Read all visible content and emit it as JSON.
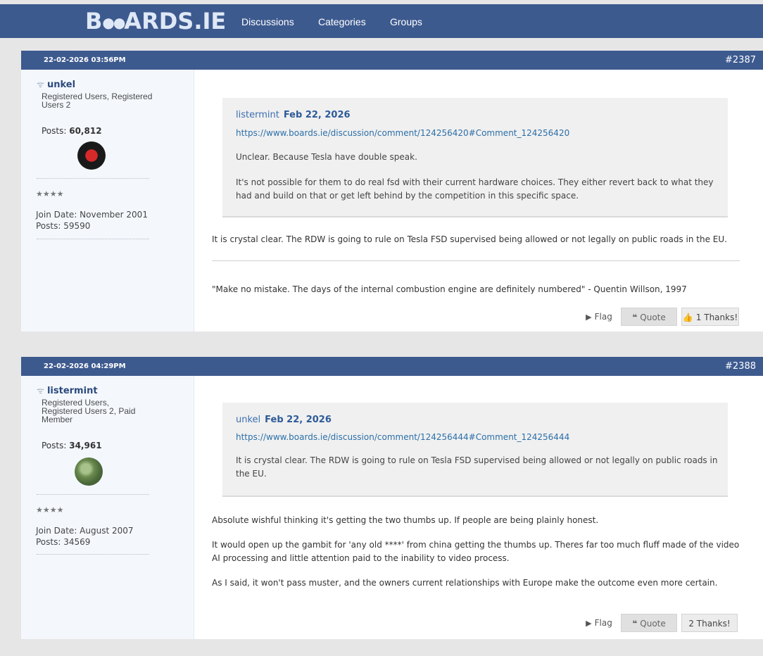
{
  "header": {
    "logo": "BOARDS.IE",
    "nav": [
      "Discussions",
      "Categories",
      "Groups"
    ]
  },
  "posts": [
    {
      "date": "22-02-2026 03:56PM",
      "number": "#2387",
      "username": "unkel",
      "roles": "Registered Users, Registered Users 2",
      "posts_label": "Posts:",
      "posts_count": "60,812",
      "stars": "★★★★",
      "join_date": "Join Date: November 2001",
      "posts_total": "Posts: 59590",
      "quote": {
        "author": "listermint",
        "date": "Feb 22, 2026",
        "link": "https://www.boards.ie/discussion/comment/124256420#Comment_124256420",
        "paragraphs": [
          "Unclear. Because Tesla have double speak.",
          "It's not possible for them to do real fsd with their current hardware choices. They either revert back to what they had and build on that or get left behind by the competition in this specific space."
        ]
      },
      "paragraphs": [
        "It is crystal clear. The RDW is going to rule on Tesla FSD supervised being allowed or not legally on public roads in the EU."
      ],
      "signature": "\"Make no mistake. The days of the internal combustion engine are definitely numbered\" - Quentin Willson, 1997",
      "actions": {
        "flag": "Flag",
        "quote": "Quote",
        "thanks": "1 Thanks!"
      }
    },
    {
      "date": "22-02-2026 04:29PM",
      "number": "#2388",
      "username": "listermint",
      "roles": "Registered Users, Registered Users 2, Paid Member",
      "posts_label": "Posts:",
      "posts_count": "34,961",
      "stars": "★★★★",
      "join_date": "Join Date: August 2007",
      "posts_total": "Posts: 34569",
      "quote": {
        "author": "unkel",
        "date": "Feb 22, 2026",
        "link": "https://www.boards.ie/discussion/comment/124256444#Comment_124256444",
        "paragraphs": [
          "It is crystal clear. The RDW is going to rule on Tesla FSD supervised being allowed or not legally on public roads in the EU."
        ]
      },
      "paragraphs": [
        "Absolute wishful thinking it's getting the two thumbs up. If people are being plainly honest.",
        "It would open up the gambit for 'any old ****' from china getting the thumbs up. Theres far too much fluff made of the video AI processing and little attention paid to the inability to video process.",
        "As I said, it won't pass muster, and the owners current relationships with Europe make the outcome even more certain."
      ],
      "actions": {
        "flag": "Flag",
        "quote": "Quote",
        "thanks": "2 Thanks!"
      }
    }
  ],
  "colors": {
    "header_bg": "#3d5a8f",
    "user_panel_bg": "#f4f8fd",
    "link": "#2c6fa8"
  },
  "icons": [
    "wifi-icon",
    "flag-icon",
    "quote-icon",
    "thumbs-up-icon"
  ]
}
